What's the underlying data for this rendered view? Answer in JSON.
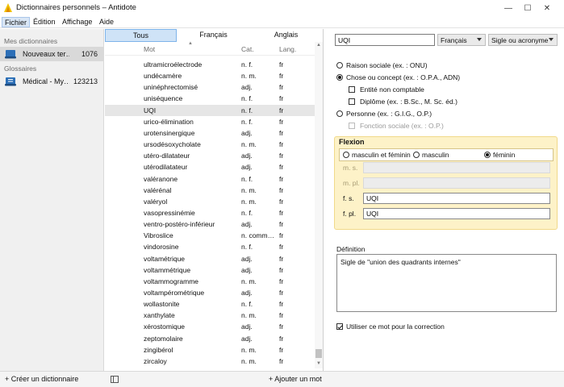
{
  "window": {
    "title": "Dictionnaires personnels – Antidote",
    "minimize": "—",
    "maximize": "☐",
    "close": "✕"
  },
  "menu": [
    "Fichier",
    "Édition",
    "Affichage",
    "Aide"
  ],
  "sidebar": {
    "section_mine": "Mes dictionnaires",
    "section_glossaries": "Glossaires",
    "items": [
      {
        "label": "Nouveaux ter…",
        "count": "1076"
      },
      {
        "label": "Médical - My…",
        "count": "123213"
      }
    ]
  },
  "filters": [
    "Tous",
    "Français",
    "Anglais"
  ],
  "columns": {
    "mot": "Mot",
    "cat": "Cat.",
    "lang": "Lang."
  },
  "rows": [
    {
      "mot": "ultramicroélectrode",
      "cat": "n. f.",
      "lang": "fr"
    },
    {
      "mot": "undécamère",
      "cat": "n. m.",
      "lang": "fr"
    },
    {
      "mot": "uninéphrectomisé",
      "cat": "adj.",
      "lang": "fr"
    },
    {
      "mot": "uniséquence",
      "cat": "n. f.",
      "lang": "fr"
    },
    {
      "mot": "UQI",
      "cat": "n. f.",
      "lang": "fr"
    },
    {
      "mot": "urico-élimination",
      "cat": "n. f.",
      "lang": "fr"
    },
    {
      "mot": "urotensinergique",
      "cat": "adj.",
      "lang": "fr"
    },
    {
      "mot": "ursodésoxycholate",
      "cat": "n. m.",
      "lang": "fr"
    },
    {
      "mot": "utéro-dilatateur",
      "cat": "adj.",
      "lang": "fr"
    },
    {
      "mot": "utérodilatateur",
      "cat": "adj.",
      "lang": "fr"
    },
    {
      "mot": "valéranone",
      "cat": "n. f.",
      "lang": "fr"
    },
    {
      "mot": "valérénal",
      "cat": "n. m.",
      "lang": "fr"
    },
    {
      "mot": "valéryol",
      "cat": "n. m.",
      "lang": "fr"
    },
    {
      "mot": "vasopressinémie",
      "cat": "n. f.",
      "lang": "fr"
    },
    {
      "mot": "ventro-postéro-inférieur",
      "cat": "adj.",
      "lang": "fr"
    },
    {
      "mot": "Vibroslice",
      "cat": "n. comm…",
      "lang": "fr"
    },
    {
      "mot": "vindorosine",
      "cat": "n. f.",
      "lang": "fr"
    },
    {
      "mot": "voltamétrique",
      "cat": "adj.",
      "lang": "fr"
    },
    {
      "mot": "voltammétrique",
      "cat": "adj.",
      "lang": "fr"
    },
    {
      "mot": "voltammogramme",
      "cat": "n. m.",
      "lang": "fr"
    },
    {
      "mot": "voltampérométrique",
      "cat": "adj.",
      "lang": "fr"
    },
    {
      "mot": "wollastonite",
      "cat": "n. f.",
      "lang": "fr"
    },
    {
      "mot": "xanthylate",
      "cat": "n. m.",
      "lang": "fr"
    },
    {
      "mot": "xérostomique",
      "cat": "adj.",
      "lang": "fr"
    },
    {
      "mot": "zeptomolaire",
      "cat": "adj.",
      "lang": "fr"
    },
    {
      "mot": "zingibérol",
      "cat": "n. m.",
      "lang": "fr"
    },
    {
      "mot": "zircaloy",
      "cat": "n. m.",
      "lang": "fr"
    }
  ],
  "footer": {
    "create": "+ Créer un dictionnaire",
    "add": "+ Ajouter un mot"
  },
  "detail": {
    "word": "UQI",
    "language": "Français",
    "type": "Sigle ou acronyme",
    "opt_raison": "Raison sociale (ex. : ONU)",
    "opt_chose": "Chose ou concept (ex. : O.P.A., ADN)",
    "chk_non_comptable": "Entité non comptable",
    "chk_diplome": "Diplôme (ex. : B.Sc., M. Sc. éd.)",
    "opt_personne": "Personne (ex. : G.I.G., O.P.)",
    "chk_fonction": "Fonction sociale (ex. : O.P.)",
    "flexion_title": "Flexion",
    "gender": [
      "masculin et féminin",
      "masculin",
      "féminin"
    ],
    "ms_label": "m. s.",
    "mpl_label": "m. pl.",
    "fs_label": "f. s.",
    "fpl_label": "f. pl.",
    "fs_value": "UQI",
    "fpl_value": "UQI",
    "definition_label": "Définition",
    "definition": "Sigle de \"union des quadrants internes\"",
    "use_correction": "Utiliser ce mot pour la correction"
  }
}
